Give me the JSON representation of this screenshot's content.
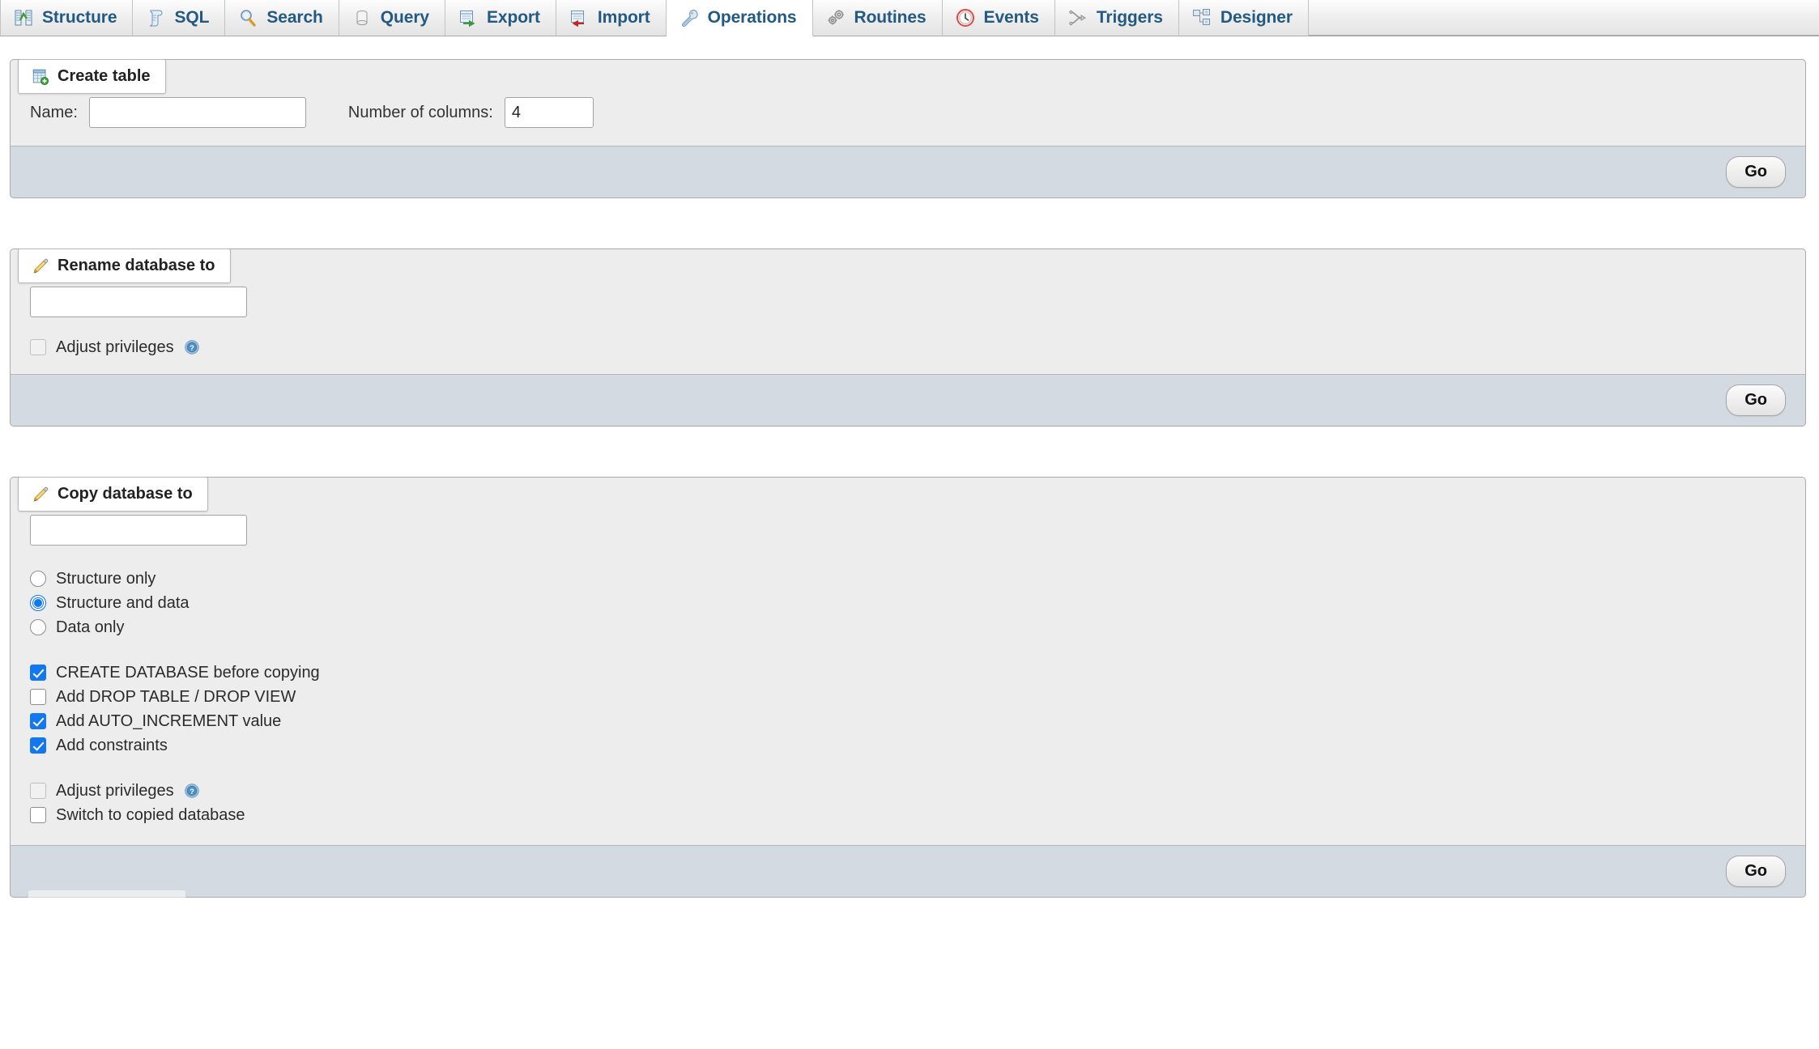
{
  "tabs": [
    {
      "label": "Structure",
      "icon": "structure-icon",
      "active": false
    },
    {
      "label": "SQL",
      "icon": "sql-icon",
      "active": false
    },
    {
      "label": "Search",
      "icon": "search-icon",
      "active": false
    },
    {
      "label": "Query",
      "icon": "query-icon",
      "active": false
    },
    {
      "label": "Export",
      "icon": "export-icon",
      "active": false
    },
    {
      "label": "Import",
      "icon": "import-icon",
      "active": false
    },
    {
      "label": "Operations",
      "icon": "wrench-icon",
      "active": true
    },
    {
      "label": "Routines",
      "icon": "routines-icon",
      "active": false
    },
    {
      "label": "Events",
      "icon": "clock-icon",
      "active": false
    },
    {
      "label": "Triggers",
      "icon": "triggers-icon",
      "active": false
    },
    {
      "label": "Designer",
      "icon": "designer-icon",
      "active": false
    }
  ],
  "create_table": {
    "legend": "Create table",
    "legend_icon": "new-table-icon",
    "name_label": "Name:",
    "name_value": "",
    "columns_label": "Number of columns:",
    "columns_value": "4",
    "go_label": "Go"
  },
  "rename_database": {
    "legend": "Rename database to",
    "legend_icon": "pencil-icon",
    "dbname_value": "",
    "adjust_privileges_label": "Adjust privileges",
    "adjust_privileges_checked": false,
    "help_icon": "help-icon",
    "go_label": "Go"
  },
  "copy_database": {
    "legend": "Copy database to",
    "legend_icon": "pencil-icon",
    "dbname_value": "",
    "radios": [
      {
        "label": "Structure only",
        "checked": false
      },
      {
        "label": "Structure and data",
        "checked": true
      },
      {
        "label": "Data only",
        "checked": false
      }
    ],
    "checkboxes": [
      {
        "label": "CREATE DATABASE before copying",
        "checked": true,
        "disabled": false,
        "help": false
      },
      {
        "label": "Add DROP TABLE / DROP VIEW",
        "checked": false,
        "disabled": false,
        "help": false
      },
      {
        "label": "Add AUTO_INCREMENT value",
        "checked": true,
        "disabled": false,
        "help": false
      },
      {
        "label": "Add constraints",
        "checked": true,
        "disabled": false,
        "help": false
      }
    ],
    "checkboxes2": [
      {
        "label": "Adjust privileges",
        "checked": false,
        "disabled": true,
        "help": true
      },
      {
        "label": "Switch to copied database",
        "checked": false,
        "disabled": false,
        "help": false
      }
    ],
    "go_label": "Go"
  },
  "colors": {
    "tab_text": "#235a81",
    "fieldset_bg": "#ededed",
    "footer_bg": "#d4dae1",
    "accent_blue": "#1277f0"
  }
}
